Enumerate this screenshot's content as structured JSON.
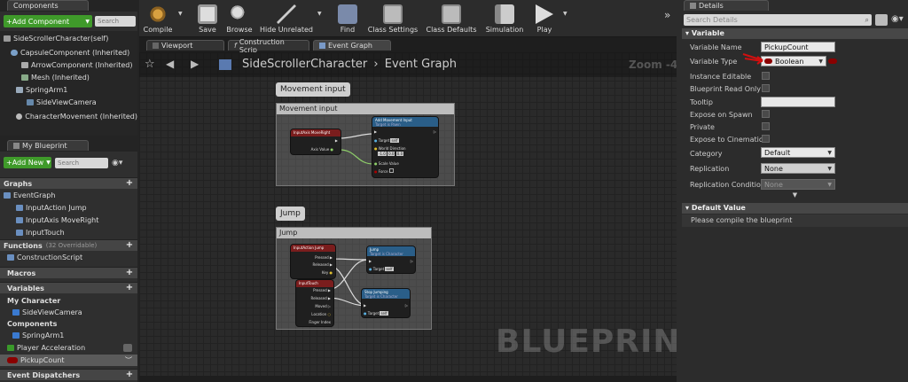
{
  "components_panel": {
    "tab": "Components",
    "add_button": "+Add Component",
    "search_placeholder": "Search",
    "items": [
      "SideScrollerCharacter(self)",
      "CapsuleComponent (Inherited)",
      "ArrowComponent (Inherited)",
      "Mesh (Inherited)",
      "SpringArm1",
      "SideViewCamera",
      "CharacterMovement (Inherited)"
    ]
  },
  "blueprint_panel": {
    "tab": "My Blueprint",
    "add_button": "+Add New",
    "search_placeholder": "Search",
    "graphs_label": "Graphs",
    "event_graph": "EventGraph",
    "graph_items": [
      "InputAction Jump",
      "InputAxis MoveRight",
      "InputTouch"
    ],
    "functions_label": "Functions",
    "functions_count": "(32 Overridable)",
    "construction_script": "ConstructionScript",
    "macros_label": "Macros",
    "variables_label": "Variables",
    "my_character_label": "My Character",
    "side_view_camera": "SideViewCamera",
    "components_label": "Components",
    "spring_arm": "SpringArm1",
    "player_acceleration": "Player Acceleration",
    "pickup_count": "PickupCount",
    "event_dispatchers_label": "Event Dispatchers"
  },
  "toolbar": {
    "compile": "Compile",
    "save": "Save",
    "browse": "Browse",
    "hide_unrelated": "Hide Unrelated",
    "find": "Find",
    "class_settings": "Class Settings",
    "class_defaults": "Class Defaults",
    "simulation": "Simulation",
    "play": "Play"
  },
  "editor_tabs": [
    "Viewport",
    "Construction Scrip",
    "Event Graph"
  ],
  "graph": {
    "breadcrumb_root": "SideScrollerCharacter",
    "breadcrumb_current": "Event Graph",
    "zoom": "Zoom -4",
    "watermark": "BLUEPRINT",
    "comment_movement": "Movement input",
    "comment_jump": "Jump",
    "nodes": {
      "input_axis": "InputAxis MoveRight",
      "axis_value": "Axis Value",
      "add_movement": "Add Movement Input",
      "target_is_pawn": "Target is Pawn",
      "target": "Target",
      "self": "self",
      "world_direction": "World Direction",
      "dir_x": "-1.0",
      "dir_y": "0.0",
      "dir_z": "0.0",
      "scale_value": "Scale Value",
      "force": "Force",
      "input_action_jump": "InputAction Jump",
      "pressed": "Pressed",
      "released": "Released",
      "key": "Key",
      "input_touch": "InputTouch",
      "moved": "Moved",
      "location": "Location",
      "finger_index": "Finger Index",
      "jump": "Jump",
      "target_is_character": "Target is Character",
      "stop_jumping": "Stop Jumping"
    }
  },
  "details": {
    "tab": "Details",
    "search_placeholder": "Search Details",
    "variable_section": "Variable",
    "variable_name_label": "Variable Name",
    "variable_name_value": "PickupCount",
    "variable_type_label": "Variable Type",
    "variable_type_value": "Boolean",
    "instance_editable": "Instance Editable",
    "read_only": "Blueprint Read Only",
    "tooltip": "Tooltip",
    "expose_spawn": "Expose on Spawn",
    "private": "Private",
    "expose_cinematics": "Expose to Cinematics",
    "category_label": "Category",
    "category_value": "Default",
    "replication_label": "Replication",
    "replication_value": "None",
    "replication_condition_label": "Replication Condition",
    "replication_condition_value": "None",
    "default_section": "Default Value",
    "compile_msg": "Please compile the blueprint"
  },
  "colors": {
    "add_green": "#3f9a2a",
    "event_red": "#7a1d1d",
    "function_blue": "#2a5e88",
    "bool_var_red": "#8a0000"
  }
}
